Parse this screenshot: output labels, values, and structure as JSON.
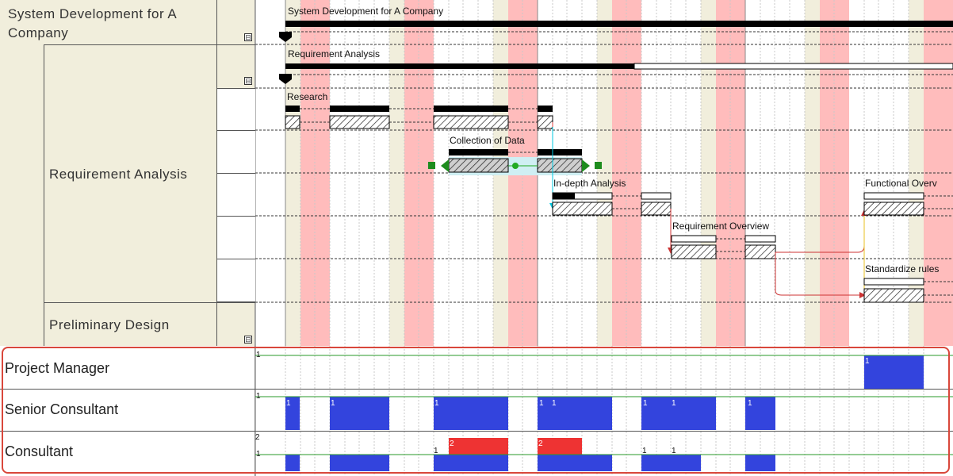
{
  "outline": {
    "project": "System Development for A Company",
    "phase": "Requirement Analysis",
    "task_group": "Requirement Analysis",
    "next_phase": "Preliminary Design",
    "collapse_symbol": "⊟"
  },
  "gantt": {
    "bars": {
      "project": "System Development for A Company",
      "phase": "Requirement Analysis",
      "research": "Research",
      "collection": "Collection of Data",
      "indepth": "In-depth Analysis",
      "req_overview": "Requirement Overview",
      "functional": "Functional Overv",
      "standardize": "Standardize rules"
    }
  },
  "resources": {
    "rows": [
      {
        "name": "Project Manager",
        "max_label": "1",
        "loads": [
          "1"
        ]
      },
      {
        "name": "Senior Consultant",
        "max_label": "1",
        "loads": [
          "1",
          "1",
          "1",
          "1",
          "1",
          "1",
          "1",
          "1"
        ]
      },
      {
        "name": "Consultant",
        "max_label_top": "2",
        "max_label": "1",
        "loads": [
          "2",
          "2",
          "1",
          "1",
          "1"
        ]
      }
    ]
  },
  "colors": {
    "weekend": "#ffbcbc",
    "offday": "#f1eedc",
    "resource_blue": "#3344dd",
    "resource_red": "#ee3333",
    "highlight_border": "#d9473b"
  }
}
